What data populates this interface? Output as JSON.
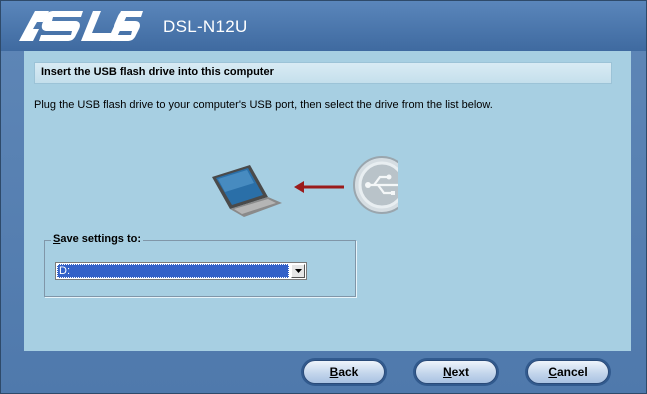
{
  "header": {
    "brand": "ASUS",
    "model": "DSL-N12U"
  },
  "panel": {
    "banner_title": "Insert the USB flash drive into this computer",
    "instruction": "Plug the USB flash drive to your computer's USB port, then select the drive from the list below."
  },
  "save_group": {
    "label_first": "S",
    "label_rest": "ave settings to:",
    "selected_drive": "D:"
  },
  "buttons": {
    "back_first": "B",
    "back_rest": "ack",
    "next_first": "N",
    "next_rest": "ext",
    "cancel_first": "C",
    "cancel_rest": "ancel"
  },
  "colors": {
    "panel_bg": "#a7cfe2",
    "window_bg": "#5f87b7",
    "selection": "#3361c8",
    "arrow": "#9b1b1b"
  }
}
